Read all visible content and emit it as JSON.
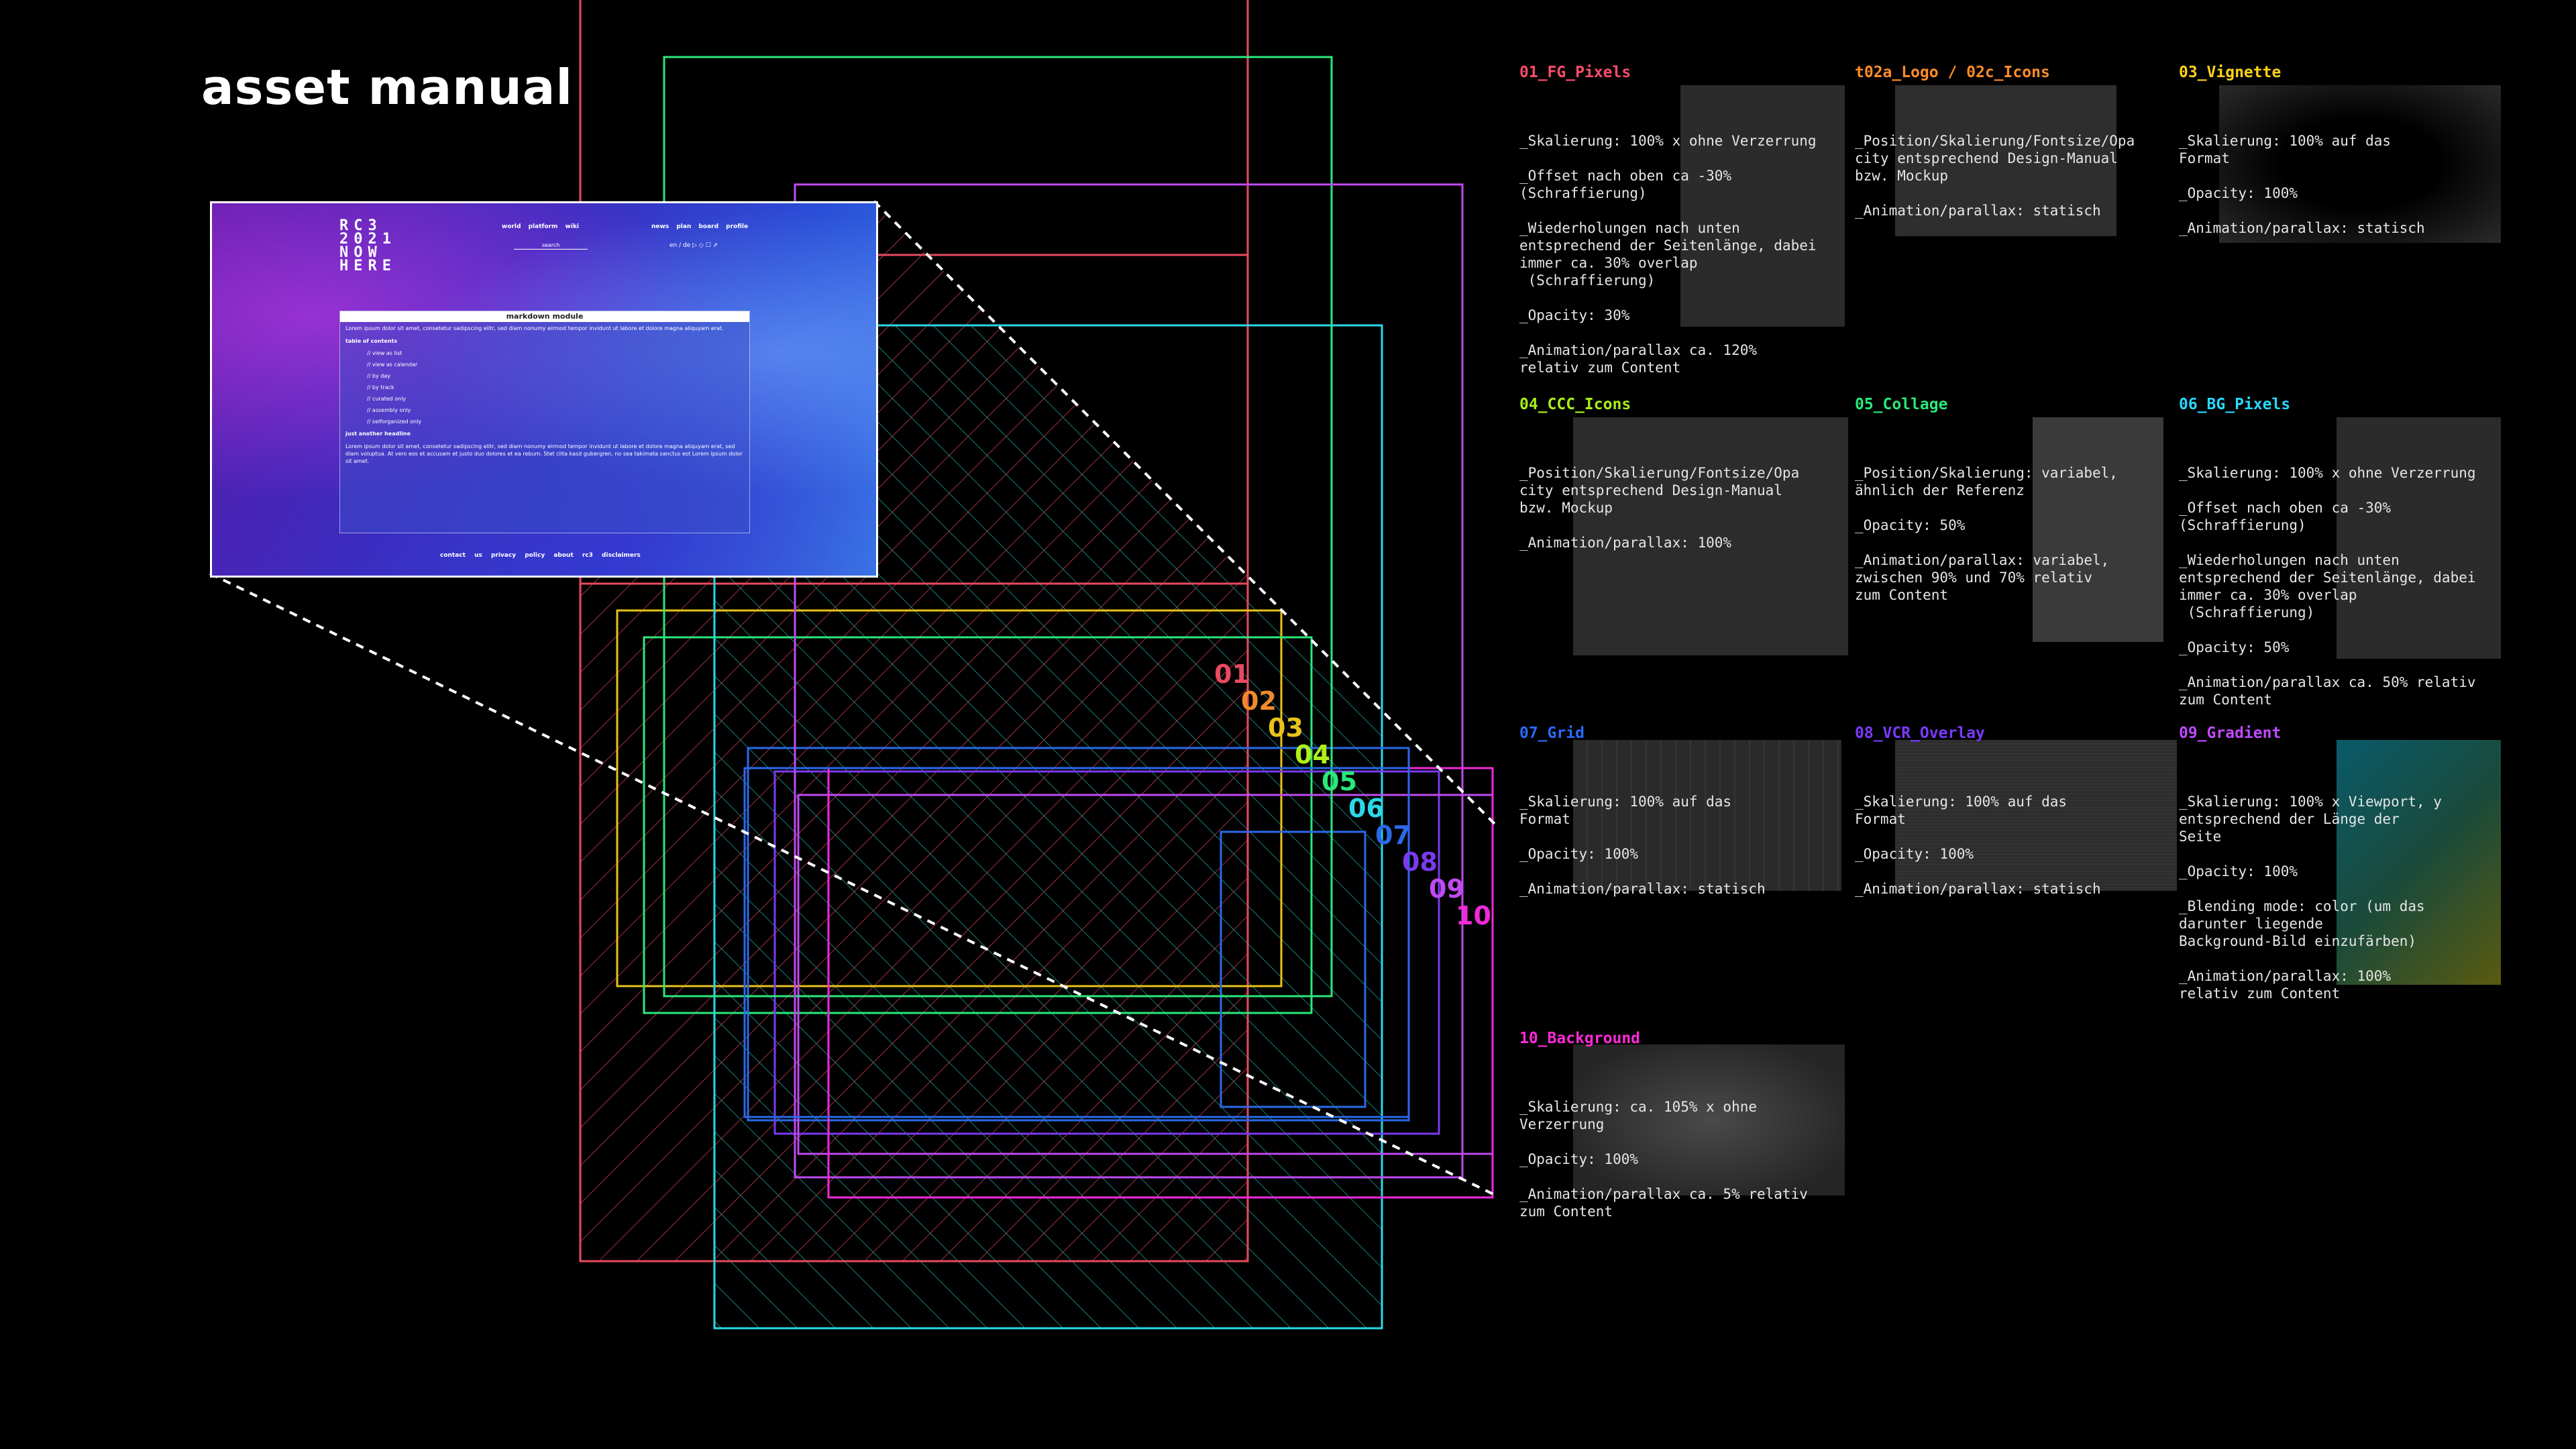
{
  "page": {
    "title": "asset manual"
  },
  "diagram": {
    "layers": [
      {
        "label": "01",
        "color": "#e84a5f"
      },
      {
        "label": "02",
        "color": "#f08a2a"
      },
      {
        "label": "03",
        "color": "#e8c21a"
      },
      {
        "label": "04",
        "color": "#aef01a"
      },
      {
        "label": "05",
        "color": "#2ae87a"
      },
      {
        "label": "06",
        "color": "#2ad8e8"
      },
      {
        "label": "07",
        "color": "#2a6ae8"
      },
      {
        "label": "08",
        "color": "#7a3af0"
      },
      {
        "label": "09",
        "color": "#c04af0"
      },
      {
        "label": "10",
        "color": "#f02ad8"
      }
    ]
  },
  "mockup": {
    "logo": "RC3\n2021\nNOW\nHERE",
    "nav_main": "world  platform  wiki",
    "nav_right": "news  plan  board  profile",
    "search": "search",
    "lang": "en / de",
    "panel_title": "markdown module",
    "intro": "Lorem ipsum dolor sit amet, consetetur sadipscing elitr, sed diam nonumy eirmod tempor invidunt ut labore et dolore magna aliquyam erat.",
    "toc_title": "table of contents",
    "toc": [
      "view as list",
      "view as calendar",
      "by day",
      "by track",
      "curated only",
      "assembly only",
      "selforganized only"
    ],
    "headline": "just another headline",
    "body": "Lorem ipsum dolor sit amet, consetetur sadipscing elitr, sed diam nonumy eirmod tempor invidunt ut labore et dolore magna aliquyam erat, sed diam voluptua. At vero eos et accusam et justo duo dolores et ea rebum. Stet clita kasd gubergren, no sea takimata sanctus est Lorem ipsum dolor sit amet.",
    "footer": "contact us   privacy policy   about rc3   disclaimers"
  },
  "assets": [
    {
      "title": "01_FG_Pixels",
      "color": "#ff4d6a",
      "body": "_Skalierung: 100% x ohne Verzerrung\n\n_Offset nach oben ca -30%\n(Schraffierung)\n\n_Wiederholungen nach unten\nentsprechend der Seitenlänge, dabei\nimmer ca. 30% overlap\n (Schraffierung)\n\n_Opacity: 30%\n\n_Animation/parallax ca. 120%\nrelativ zum Content"
    },
    {
      "title": "t02a_Logo / 02c_Icons",
      "color": "#ff8c2a",
      "body": "_Position/Skalierung/Fontsize/Opa\ncity entsprechend Design-Manual\nbzw. Mockup\n\n_Animation/parallax: statisch"
    },
    {
      "title": "03_Vignette",
      "color": "#ffd21a",
      "body": "_Skalierung: 100% auf das\nFormat\n\n_Opacity: 100%\n\n_Animation/parallax: statisch"
    },
    {
      "title": "04_CCC_Icons",
      "color": "#a8f01a",
      "body": "_Position/Skalierung/Fontsize/Opa\ncity entsprechend Design-Manual\nbzw. Mockup\n\n_Animation/parallax: 100%"
    },
    {
      "title": "05_Collage",
      "color": "#2ae87a",
      "body": "_Position/Skalierung: variabel,\nähnlich der Referenz\n\n_Opacity: 50%\n\n_Animation/parallax: variabel,\nzwischen 90% und 70% relativ\nzum Content"
    },
    {
      "title": "06_BG_Pixels",
      "color": "#2ad8ff",
      "body": "_Skalierung: 100% x ohne Verzerrung\n\n_Offset nach oben ca -30%\n(Schraffierung)\n\n_Wiederholungen nach unten\nentsprechend der Seitenlänge, dabei\nimmer ca. 30% overlap\n (Schraffierung)\n\n_Opacity: 50%\n\n_Animation/parallax ca. 50% relativ\nzum Content"
    },
    {
      "title": "07_Grid",
      "color": "#2a6aff",
      "body": "_Skalierung: 100% auf das\nFormat\n\n_Opacity: 100%\n\n_Animation/parallax: statisch"
    },
    {
      "title": "08_VCR_Overlay",
      "color": "#7a3aff",
      "body": "_Skalierung: 100% auf das\nFormat\n\n_Opacity: 100%\n\n_Animation/parallax: statisch"
    },
    {
      "title": "09_Gradient",
      "color": "#c04aff",
      "body": "_Skalierung: 100% x Viewport, y\nentsprechend der Länge der\nSeite\n\n_Opacity: 100%\n\n_Blending mode: color (um das\ndarunter liegende\nBackground-Bild einzufärben)\n\n_Animation/parallax: 100%\nrelativ zum Content"
    },
    {
      "title": "10_Background",
      "color": "#ff2ad8",
      "body": "_Skalierung: ca. 105% x ohne\nVerzerrung\n\n_Opacity: 100%\n\n_Animation/parallax ca. 5% relativ\nzum Content"
    }
  ]
}
